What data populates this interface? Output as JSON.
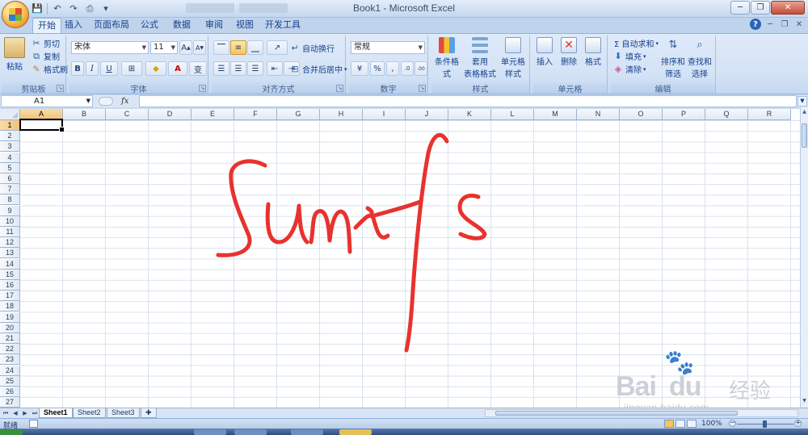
{
  "window": {
    "title": "Book1 - Microsoft Excel",
    "controls": [
      "─",
      "❐",
      "✕"
    ]
  },
  "qat": {
    "save": "💾",
    "undo": "↶",
    "redo": "↷",
    "preview": "⎙",
    "more": "▾"
  },
  "ribbon_tabs": [
    "开始",
    "插入",
    "页面布局",
    "公式",
    "数据",
    "审阅",
    "视图",
    "开发工具"
  ],
  "active_tab": "开始",
  "groups": {
    "clipboard": {
      "label": "剪贴板",
      "paste": "粘贴",
      "cut": "剪切",
      "copy": "复制",
      "format_painter": "格式刷"
    },
    "font": {
      "label": "字体",
      "font_name": "宋体",
      "font_size": "11",
      "bold": "B",
      "italic": "I",
      "underline": "U",
      "grow": "A",
      "shrink": "A",
      "font_color_letter": "A",
      "phonetic": "变"
    },
    "alignment": {
      "label": "对齐方式",
      "wrap_text": "自动换行",
      "merge_center": "合并后居中"
    },
    "number": {
      "label": "数字",
      "format": "常规",
      "percent": "%",
      "comma": ",",
      "inc_decimal": ".0",
      "dec_decimal": ".00"
    },
    "styles": {
      "label": "样式",
      "conditional": "条件格式",
      "table_format_1": "套用",
      "table_format_2": "表格格式",
      "cell_styles_1": "单元格",
      "cell_styles_2": "样式"
    },
    "cells": {
      "label": "单元格",
      "insert": "插入",
      "delete": "删除",
      "format": "格式"
    },
    "editing": {
      "label": "编辑",
      "autosum": "Σ 自动求和",
      "fill": "填充",
      "clear": "清除",
      "sort_filter_1": "排序和",
      "sort_filter_2": "筛选",
      "find_select_1": "查找和",
      "find_select_2": "选择"
    }
  },
  "formula_bar": {
    "name_box": "A1",
    "fx": "fx",
    "value": ""
  },
  "columns": [
    "A",
    "B",
    "C",
    "D",
    "E",
    "F",
    "G",
    "H",
    "I",
    "J",
    "K",
    "L",
    "M",
    "N",
    "O",
    "P",
    "Q",
    "R"
  ],
  "rows": [
    "1",
    "2",
    "3",
    "4",
    "5",
    "6",
    "7",
    "8",
    "9",
    "10",
    "11",
    "12",
    "13",
    "14",
    "15",
    "16",
    "17",
    "18",
    "19",
    "20",
    "21",
    "22",
    "23",
    "24",
    "25",
    "26",
    "27"
  ],
  "active_cell": "A1",
  "handwriting": {
    "text": "Sumifs",
    "color": "#e8322f"
  },
  "sheets": [
    "Sheet1",
    "Sheet2",
    "Sheet3"
  ],
  "active_sheet": "Sheet1",
  "status": {
    "ready": "就绪",
    "zoom": "100%"
  },
  "watermark": {
    "brand": "Bai",
    "brand_cn": "经验",
    "url": "jingyan.baidu.com"
  }
}
